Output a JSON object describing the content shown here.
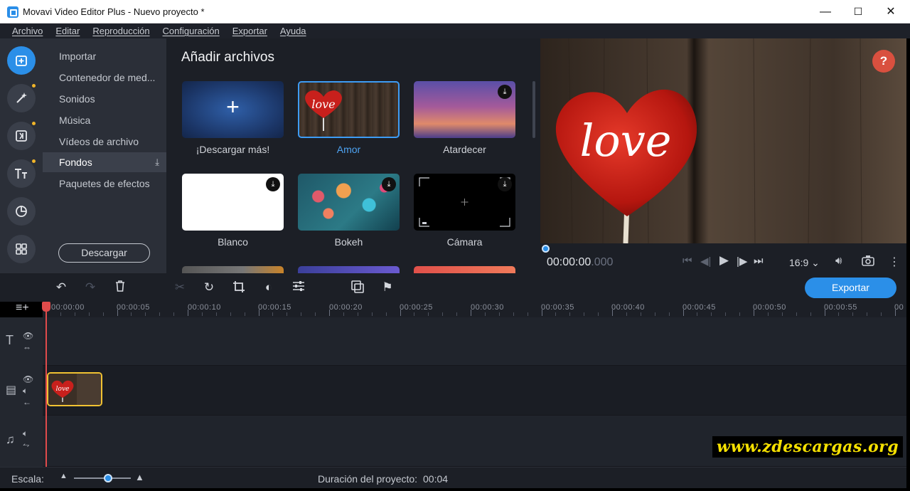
{
  "window": {
    "title": "Movavi Video Editor Plus - Nuevo proyecto *",
    "minimize": "—",
    "maximize": "☐",
    "close": "✕"
  },
  "menu": [
    "Archivo",
    "Editar",
    "Reproducción",
    "Configuración",
    "Exportar",
    "Ayuda"
  ],
  "rail_icons": [
    "import-icon",
    "magic-wand-icon",
    "transitions-icon",
    "titles-icon",
    "stickers-icon",
    "more-tools-icon"
  ],
  "categories": {
    "items": [
      "Importar",
      "Contenedor de med...",
      "Sonidos",
      "Música",
      "Vídeos de archivo",
      "Fondos",
      "Paquetes de efectos"
    ],
    "selected": "Fondos",
    "download_label": "Descargar"
  },
  "content": {
    "heading": "Añadir archivos",
    "tiles": [
      {
        "label": "¡Descargar más!"
      },
      {
        "label": "Amor"
      },
      {
        "label": "Atardecer"
      },
      {
        "label": "Blanco"
      },
      {
        "label": "Bokeh"
      },
      {
        "label": "Cámara"
      }
    ],
    "add_symbol": "+",
    "love_text": "love"
  },
  "preview": {
    "help": "?",
    "timecode_main": "00:00:00",
    "timecode_ms": ".000",
    "ratio": "16:9 ⌄"
  },
  "toolbar": {
    "export_label": "Exportar"
  },
  "ruler": {
    "ticks": [
      "00:00:00",
      "00:00:05",
      "00:00:10",
      "00:00:15",
      "00:00:20",
      "00:00:25",
      "00:00:30",
      "00:00:35",
      "00:00:40",
      "00:00:45",
      "00:00:50",
      "00:00:55",
      "00"
    ]
  },
  "status": {
    "scale_label": "Escala:",
    "duration_label": "Duración del proyecto:",
    "duration_value": "00:04"
  },
  "watermark": "www.zdescargas.org",
  "colors": {
    "accent": "#2b8fe8",
    "clip_border": "#f1c232",
    "playhead": "#e04b4b",
    "help": "#d9503f"
  }
}
